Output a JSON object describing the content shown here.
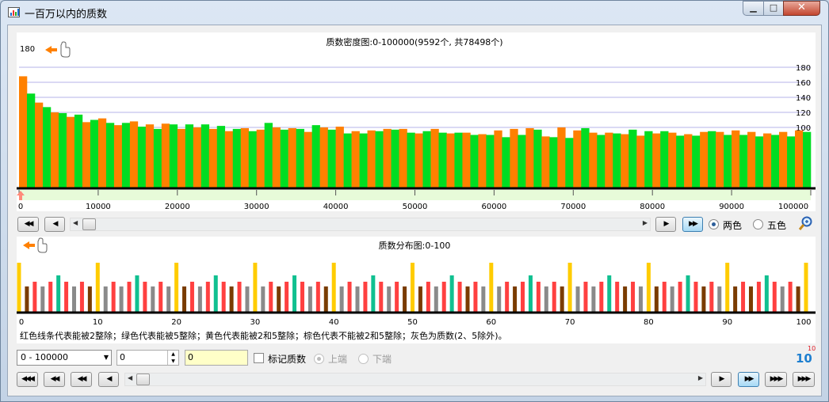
{
  "window": {
    "title": "一百万以内的质数",
    "icon": "bar-chart-icon"
  },
  "density_chart": {
    "title": "质数密度图:0-100000(9592个, 共78498个)",
    "left_top_label": "180",
    "right_ticks": [
      "180",
      "160",
      "140",
      "120",
      "100"
    ],
    "x_ticks": [
      "0",
      "10000",
      "20000",
      "30000",
      "40000",
      "50000",
      "60000",
      "70000",
      "80000",
      "90000",
      "100000"
    ],
    "colors": {
      "orange": "#ff8000",
      "green": "#00dd22"
    }
  },
  "chart_data": [
    {
      "type": "bar",
      "title": "质数密度图:0-100000(9592个, 共78498个)",
      "xlabel": "",
      "ylabel": "",
      "xlim": [
        0,
        100000
      ],
      "ylim": [
        0,
        180
      ],
      "bin_width": 1000,
      "color_pattern": "alternating orange / green per bin",
      "values": [
        168,
        145,
        133,
        127,
        120,
        119,
        114,
        117,
        107,
        110,
        112,
        106,
        103,
        106,
        108,
        101,
        104,
        98,
        105,
        104,
        98,
        104,
        100,
        104,
        98,
        102,
        95,
        98,
        99,
        95,
        97,
        106,
        100,
        97,
        99,
        98,
        94,
        103,
        100,
        97,
        101,
        92,
        95,
        92,
        96,
        95,
        98,
        97,
        98,
        93,
        92,
        95,
        98,
        93,
        92,
        93,
        93,
        90,
        91,
        90,
        96,
        87,
        98,
        90,
        99,
        97,
        88,
        87,
        100,
        86,
        96,
        99,
        93,
        90,
        93,
        92,
        91,
        97,
        89,
        95,
        92,
        95,
        93,
        89,
        91,
        89,
        94,
        95,
        94,
        90,
        96,
        90,
        94,
        88,
        92,
        90,
        94,
        88,
        96,
        94
      ]
    },
    {
      "type": "bar",
      "title": "质数分布图:0-100",
      "xlabel": "",
      "ylabel": "",
      "xlim": [
        0,
        100
      ],
      "x_ticks": [
        0,
        10,
        20,
        30,
        40,
        50,
        60,
        70,
        80,
        90,
        100
      ],
      "categories_by_color": {
        "red": "能被2整除",
        "green": "能被5整除",
        "yellow": "能被2和5整除",
        "brown": "不能被2和5整除",
        "gray": "质数"
      },
      "colors": {
        "red": "#ff4040",
        "green": "#10c090",
        "yellow": "#ffcc00",
        "brown": "#7a3c00",
        "gray": "#8a8a8a"
      }
    }
  ],
  "distribution_chart": {
    "title": "质数分布图:0-100",
    "x_ticks": [
      "0",
      "10",
      "20",
      "30",
      "40",
      "50",
      "60",
      "70",
      "80",
      "90",
      "100"
    ],
    "legend_text": "红色线条代表能被2整除；绿色代表能被5整除；黄色代表能被2和5整除；棕色代表不能被2和5整除；灰色为质数(2、5除外)。"
  },
  "nav_top": {
    "btn_first": "◀◀",
    "btn_prev": "◀",
    "btn_next": "▶",
    "btn_last": "▶▶"
  },
  "color_mode": {
    "two_color": "两色",
    "five_color": "五色",
    "selected": "两色"
  },
  "controls": {
    "range_select": "0 - 100000",
    "spin_value": "0",
    "yellow_field": "0",
    "mark_primes": "标记质数",
    "upper": "上端",
    "lower": "下端",
    "power_badge_base": "10",
    "power_badge_exp": "10"
  },
  "nav_bottom": {
    "b1": "◀◀◀",
    "b2": "◀◀",
    "b3": "◀◀",
    "b4": "◀",
    "b5": "▶",
    "b6": "▶▶",
    "b7": "▶▶▶",
    "b8": "▶▶▶"
  }
}
